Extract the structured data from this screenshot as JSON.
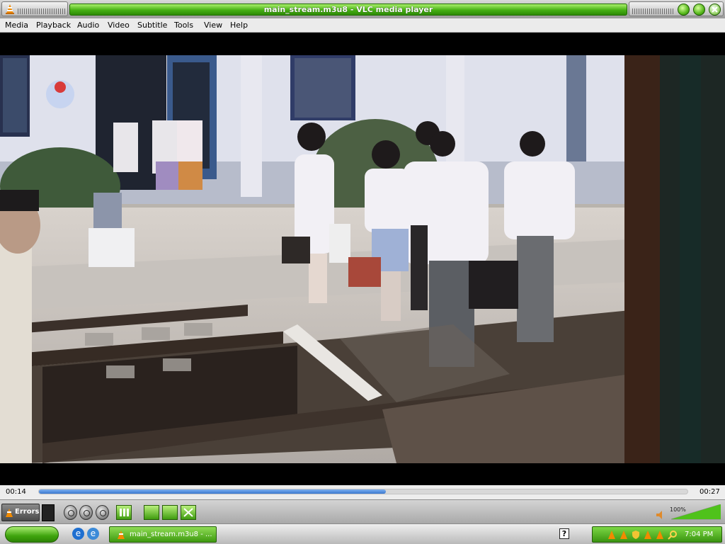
{
  "window": {
    "title": "main_stream.m3u8 - VLC media player"
  },
  "menu": {
    "items": [
      "Media",
      "Playback",
      "Audio",
      "Video",
      "Subtitle",
      "Tools",
      "View",
      "Help"
    ]
  },
  "player": {
    "current_time": "00:14",
    "total_time": "00:27",
    "progress": 0.535,
    "errors_label": "Errors",
    "volume_label": "100%",
    "volume_level": 1.0
  },
  "taskbar": {
    "task_label": "main_stream.m3u8 - ...",
    "clock": "7:04 PM",
    "help_label": "?"
  },
  "colors": {
    "accent_green": "#47b014",
    "seek_blue": "#3a78cf"
  }
}
